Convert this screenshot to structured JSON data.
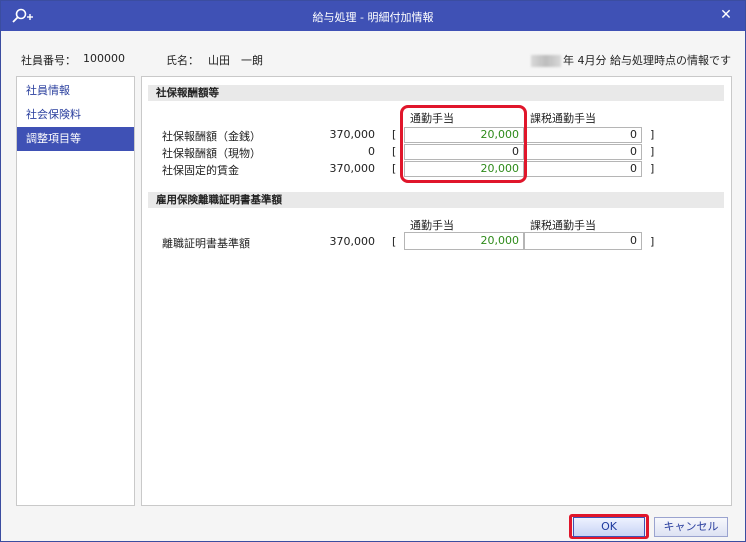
{
  "window": {
    "title": "給与処理 - 明細付加情報",
    "close_glyph": "✕",
    "app_icon": "search-plus-icon"
  },
  "info": {
    "emp_no_label": "社員番号：",
    "emp_no_value": "100000",
    "name_label": "氏名：",
    "name_value": "山田　一朗",
    "period_text": "年 4月分 給与処理時点の情報です"
  },
  "sidebar": {
    "items": [
      {
        "label": "社員情報"
      },
      {
        "label": "社会保険料"
      },
      {
        "label": "調整項目等"
      }
    ]
  },
  "section1": {
    "title": "社保報酬額等",
    "col_commute": "通勤手当",
    "col_taxable": "課税通勤手当",
    "rows": [
      {
        "label": "社保報酬額（金銭）",
        "value": "370,000",
        "commute": "20,000",
        "taxable": "0"
      },
      {
        "label": "社保報酬額（現物）",
        "value": "0",
        "commute": "0",
        "taxable": "0"
      },
      {
        "label": "社保固定的賃金",
        "value": "370,000",
        "commute": "20,000",
        "taxable": "0"
      }
    ]
  },
  "section2": {
    "title": "雇用保険離職証明書基準額",
    "col_commute": "通勤手当",
    "col_taxable": "課税通勤手当",
    "row": {
      "label": "離職証明書基準額",
      "value": "370,000",
      "commute": "20,000",
      "taxable": "0"
    }
  },
  "brackets": {
    "open": "[",
    "close": "]"
  },
  "buttons": {
    "ok": "OK",
    "cancel": "キャンセル"
  },
  "colors": {
    "titlebar": "#3f51b5",
    "highlight": "#e0162b",
    "green_value": "#2e8b1a"
  }
}
